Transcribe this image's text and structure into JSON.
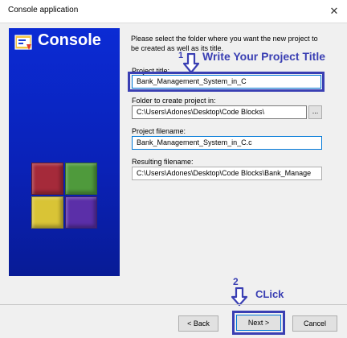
{
  "window": {
    "title": "Console application",
    "close_glyph": "✕"
  },
  "side": {
    "brand": "Console"
  },
  "intro": "Please select the folder where you want the new project to be created as well as its title.",
  "fields": {
    "project_title": {
      "label": "Project title:",
      "value": "Bank_Management_System_in_C"
    },
    "folder": {
      "label": "Folder to create project in:",
      "value": "C:\\Users\\Adones\\Desktop\\Code Blocks\\",
      "browse_label": "..."
    },
    "project_filename": {
      "label": "Project filename:",
      "value": "Bank_Management_System_in_C.c"
    },
    "resulting_filename": {
      "label": "Resulting filename:",
      "value": "C:\\Users\\Adones\\Desktop\\Code Blocks\\Bank_Manage"
    }
  },
  "annotations": {
    "step1_number": "1",
    "step1_text": "Write Your Project Title",
    "step2_number": "2",
    "step2_text": "CLick",
    "color": "#3a3fb3"
  },
  "buttons": {
    "back": "< Back",
    "next": "Next >",
    "cancel": "Cancel"
  },
  "colors": {
    "panel_blue": "#0b2bd4",
    "cube_red": "#a52a3a",
    "cube_green": "#4f9a3c",
    "cube_yellow": "#d9c436",
    "cube_purple": "#5b2fa8"
  }
}
